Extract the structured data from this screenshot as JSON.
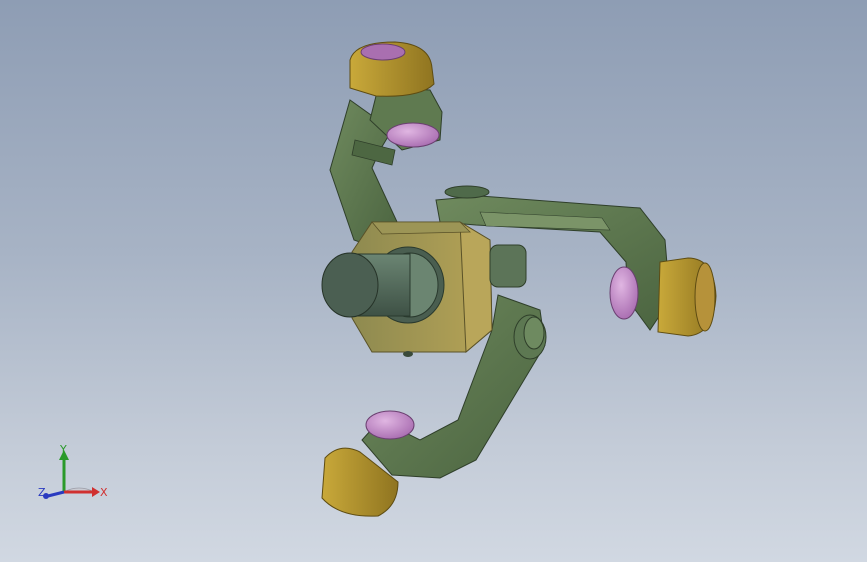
{
  "viewport": {
    "background_top": "#8e9db4",
    "background_bottom": "#d1d8e2"
  },
  "model": {
    "part_colors": {
      "arm": "#5f7a50",
      "arm_dark": "#3f5634",
      "hub": "#b09a4a",
      "shaft": "#4f6454",
      "cap": "#a68a2a",
      "pin": "#c18ac8"
    },
    "arm_count": 3
  },
  "triad": {
    "x_label": "X",
    "y_label": "Y",
    "z_label": "Z",
    "x_color": "#d03030",
    "y_color": "#2a9a2a",
    "z_color": "#2a3ac0"
  }
}
